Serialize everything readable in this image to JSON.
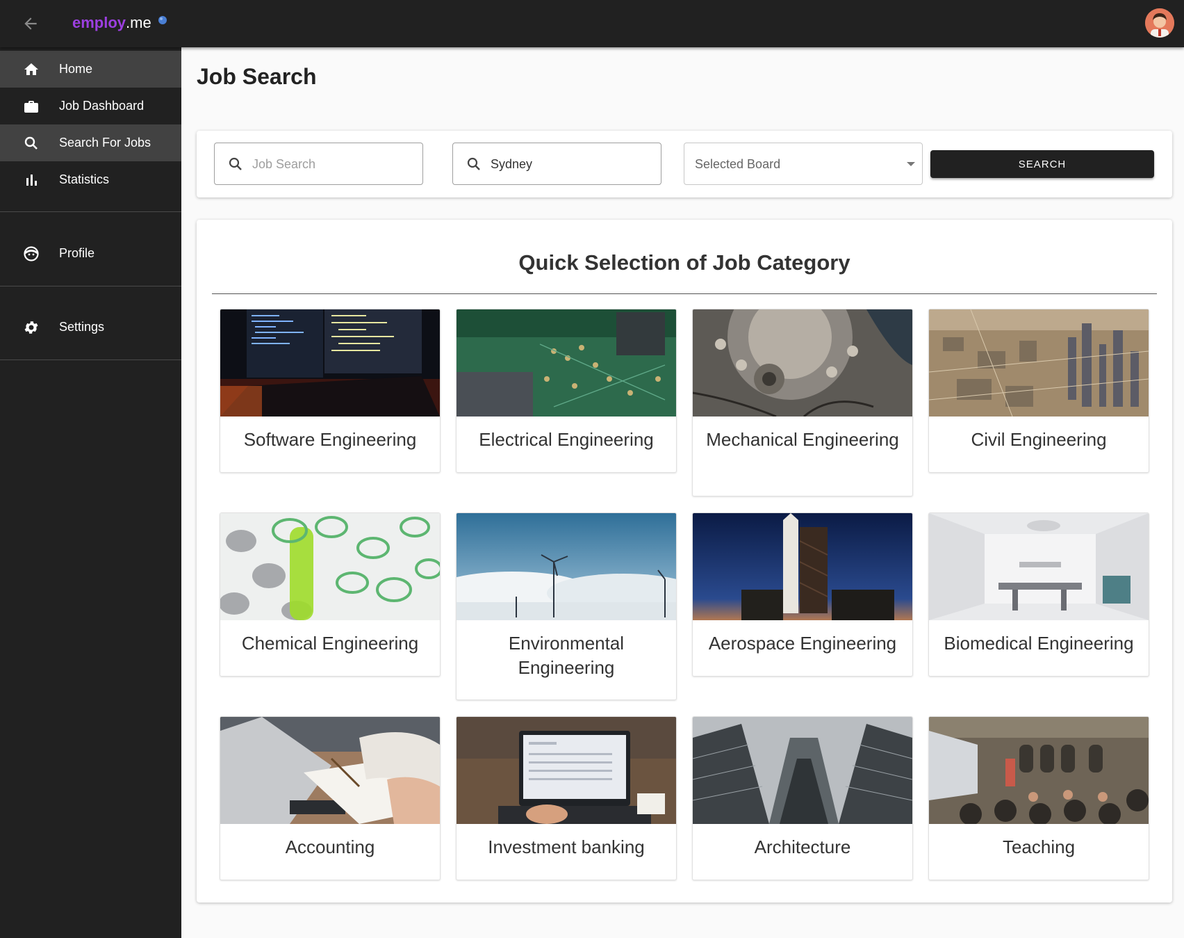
{
  "app": {
    "brand_part1": "employ",
    "brand_part2": ".me"
  },
  "colors": {
    "brand_accent": "#9c3fe0",
    "sidebar_bg": "#212121",
    "sidebar_active": "#424242",
    "button_bg": "#212121"
  },
  "sidebar": {
    "items": [
      {
        "label": "Home",
        "icon": "home-icon"
      },
      {
        "label": "Job Dashboard",
        "icon": "briefcase-icon"
      },
      {
        "label": "Search For Jobs",
        "icon": "search-icon"
      },
      {
        "label": "Statistics",
        "icon": "bar-chart-icon"
      },
      {
        "label": "Profile",
        "icon": "face-icon"
      },
      {
        "label": "Settings",
        "icon": "gear-icon"
      }
    ]
  },
  "page": {
    "title": "Job Search"
  },
  "search": {
    "job_placeholder": "Job Search",
    "location_value": "Sydney",
    "board_label": "Selected Board",
    "button_label": "SEARCH"
  },
  "categories": {
    "title": "Quick Selection of Job Category",
    "items": [
      {
        "label": "Software Engineering"
      },
      {
        "label": "Electrical Engineering"
      },
      {
        "label": "Mechanical Engineering"
      },
      {
        "label": "Civil Engineering"
      },
      {
        "label": "Chemical Engineering"
      },
      {
        "label": "Environmental Engineering"
      },
      {
        "label": "Aerospace Engineering"
      },
      {
        "label": "Biomedical Engineering"
      },
      {
        "label": "Accounting"
      },
      {
        "label": "Investment banking"
      },
      {
        "label": "Architecture"
      },
      {
        "label": "Teaching"
      }
    ]
  }
}
